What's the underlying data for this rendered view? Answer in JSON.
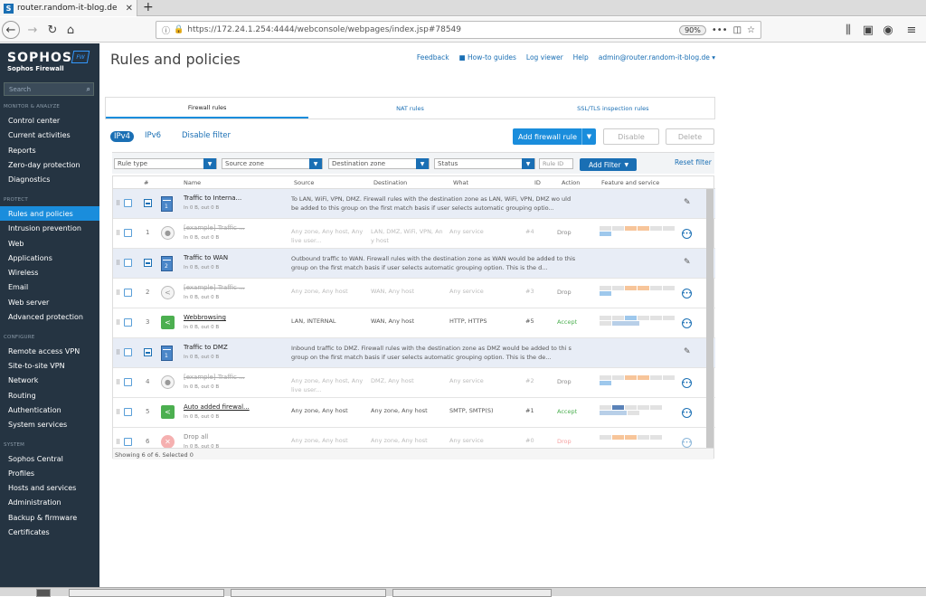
{
  "browser": {
    "tab_title": "router.random-it-blog.de",
    "tab_icon": "S",
    "new_tab": "+",
    "url_host": "https://172.24.1.254",
    "url_rest": ":4444/webconsole/webpages/index.jsp#78549",
    "zoom": "90%"
  },
  "sidebar": {
    "brand": "SOPHOS",
    "brand_sub": "Sophos Firewall",
    "badge": "FW",
    "search_placeholder": "Search",
    "sections": {
      "monitor": "MONITOR & ANALYZE",
      "protect": "PROTECT",
      "configure": "CONFIGURE",
      "system": "SYSTEM"
    },
    "items": {
      "control_center": "Control center",
      "current_activities": "Current activities",
      "reports": "Reports",
      "zero_day": "Zero-day protection",
      "diagnostics": "Diagnostics",
      "rules_policies": "Rules and policies",
      "intrusion": "Intrusion prevention",
      "web": "Web",
      "applications": "Applications",
      "wireless": "Wireless",
      "email": "Email",
      "web_server": "Web server",
      "advanced": "Advanced protection",
      "remote_vpn": "Remote access VPN",
      "site_vpn": "Site-to-site VPN",
      "network": "Network",
      "routing": "Routing",
      "authentication": "Authentication",
      "system_services": "System services",
      "sophos_central": "Sophos Central",
      "profiles": "Profiles",
      "hosts": "Hosts and services",
      "administration": "Administration",
      "backup": "Backup & firmware",
      "certificates": "Certificates"
    }
  },
  "header": {
    "title": "Rules and policies",
    "feedback": "Feedback",
    "howto": "How-to guides",
    "logviewer": "Log viewer",
    "help": "Help",
    "admin": "admin@router.random-it-blog.de ▾"
  },
  "tabs": {
    "firewall": "Firewall rules",
    "nat": "NAT rules",
    "ssl": "SSL/TLS inspection rules"
  },
  "toolbar": {
    "ipv4": "IPv4",
    "ipv6": "IPv6",
    "disable_filter": "Disable filter",
    "add_rule": "Add firewall rule",
    "disable": "Disable",
    "delete": "Delete"
  },
  "filters": {
    "rule_type": "Rule type",
    "source_zone": "Source zone",
    "dest_zone": "Destination zone",
    "status": "Status",
    "rule_id": "Rule ID",
    "add_filter": "Add Filter",
    "reset": "Reset filter"
  },
  "columns": {
    "num": "#",
    "name": "Name",
    "source": "Source",
    "destination": "Destination",
    "what": "What",
    "id": "ID",
    "action": "Action",
    "feature": "Feature and service"
  },
  "rows": [
    {
      "name": "Traffic to Interna...",
      "sub": "In 0 B, out 0 B",
      "badge": "1",
      "desc": "To LAN, WiFi, VPN, DMZ. Firewall rules with the destination zone as LAN, WiFi, VPN, DMZ wo uld be added to this group on the first match basis if user selects automatic grouping optio..."
    },
    {
      "num": "1",
      "name": "[example] Traffic ...",
      "sub": "In 0 B, out 0 B",
      "source": "Any zone, Any host, Any live user...",
      "dest": "LAN, DMZ, WiFi, VPN, An y host",
      "what": "Any service",
      "id": "#4",
      "action": "Drop"
    },
    {
      "name": "Traffic to WAN",
      "sub": "In 0 B, out 0 B",
      "badge": "2",
      "desc": "Outbound traffic to WAN. Firewall rules with the destination zone as WAN would be added to this group on the first match basis if user selects automatic grouping option. This is the d..."
    },
    {
      "num": "2",
      "name": "[example] Traffic ...",
      "sub": "In 0 B, out 0 B",
      "source": "Any zone, Any host",
      "dest": "WAN, Any host",
      "what": "Any service",
      "id": "#3",
      "action": "Drop"
    },
    {
      "num": "3",
      "name": "Webbrowsing",
      "sub": "In 0 B, out 0 B",
      "source": "LAN, INTERNAL",
      "dest": "WAN, Any host",
      "what": "HTTP, HTTPS",
      "id": "#5",
      "action": "Accept"
    },
    {
      "name": "Traffic to DMZ",
      "sub": "In 0 B, out 0 B",
      "badge": "1",
      "desc": "Inbound traffic to DMZ. Firewall rules with the destination zone as DMZ would be added to thi s group on the first match basis if user selects automatic grouping option. This is the de..."
    },
    {
      "num": "4",
      "name": "[example] Traffic ...",
      "sub": "In 0 B, out 0 B",
      "source": "Any zone, Any host, Any live user...",
      "dest": "DMZ, Any host",
      "what": "Any service",
      "id": "#2",
      "action": "Drop"
    },
    {
      "num": "5",
      "name": "Auto added firewal...",
      "sub": "In 0 B, out 0 B",
      "source": "Any zone, Any host",
      "dest": "Any zone, Any host",
      "what": "SMTP, SMTP(S)",
      "id": "#1",
      "action": "Accept"
    },
    {
      "num": "6",
      "name": "Drop all",
      "sub": "In 0 B, out 0 B",
      "source": "Any zone, Any host",
      "dest": "Any zone, Any host",
      "what": "Any service",
      "id": "#0",
      "action": "Drop"
    }
  ],
  "footer": "Showing 6 of 6. Selected 0",
  "icons": {
    "back": "back-arrow-icon",
    "forward": "forward-arrow-icon",
    "reload": "reload-icon",
    "home": "home-icon",
    "pencil": "pencil-icon",
    "more": "more-icon",
    "search": "search-icon",
    "drag": "drag-handle-icon"
  },
  "colors": {
    "accent": "#1a8ddc",
    "sidebar": "#253442",
    "accept": "#4caf50"
  }
}
